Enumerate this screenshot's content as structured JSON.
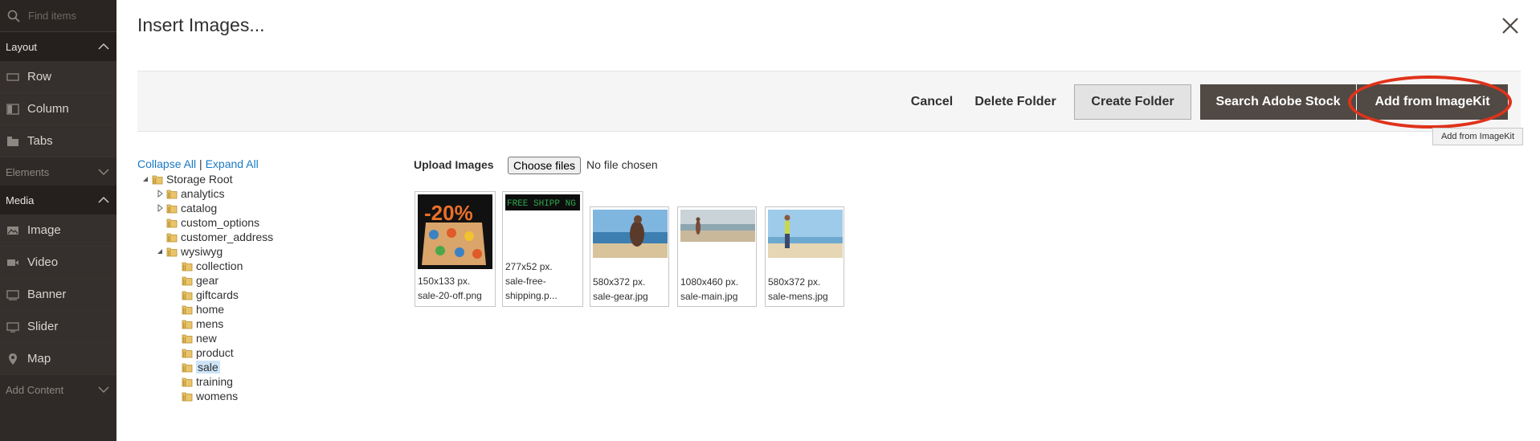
{
  "sidebar": {
    "search_placeholder": "Find items",
    "sections": {
      "layout": "Layout",
      "elements": "Elements",
      "media": "Media",
      "add_content": "Add Content"
    },
    "layout_items": [
      "Row",
      "Column",
      "Tabs"
    ],
    "media_items": [
      "Image",
      "Video",
      "Banner",
      "Slider",
      "Map"
    ]
  },
  "modal": {
    "title": "Insert Images...",
    "toolbar": {
      "cancel": "Cancel",
      "delete_folder": "Delete Folder",
      "create_folder": "Create Folder",
      "search_stock": "Search Adobe Stock",
      "add_imagekit": "Add from ImageKit"
    },
    "tooltip": "Add from ImageKit"
  },
  "tree": {
    "collapse_all": "Collapse All",
    "separator": "|",
    "expand_all": "Expand All",
    "root": "Storage Root",
    "nodes": [
      "analytics",
      "catalog",
      "custom_options",
      "customer_address",
      "wysiwyg"
    ],
    "wysiwyg_children": [
      "collection",
      "gear",
      "giftcards",
      "home",
      "mens",
      "new",
      "product",
      "sale",
      "training",
      "womens"
    ],
    "selected": "sale"
  },
  "upload": {
    "label": "Upload Images",
    "choose_button": "Choose files",
    "status": "No file chosen"
  },
  "images": [
    {
      "dims": "150x133 px.",
      "name": "sale-20-off.png",
      "preview_text": "-20%"
    },
    {
      "dims": "277x52 px.",
      "name_line1": "sale-free-",
      "name_line2": "shipping.p...",
      "preview_text": "FREE SHIPP NG"
    },
    {
      "dims": "580x372 px.",
      "name": "sale-gear.jpg"
    },
    {
      "dims": "1080x460 px.",
      "name": "sale-main.jpg"
    },
    {
      "dims": "580x372 px.",
      "name": "sale-mens.jpg"
    }
  ],
  "colors": {
    "sidebar_bg": "#2f2a27",
    "dark_button": "#514943",
    "highlight": "#e0321b",
    "link": "#1979c3"
  }
}
